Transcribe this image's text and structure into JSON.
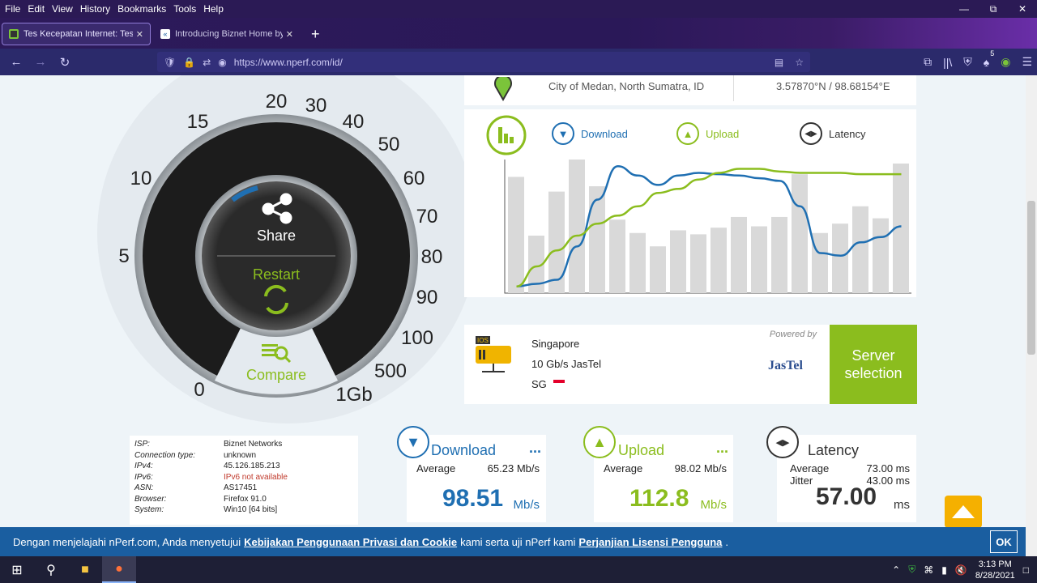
{
  "menu": [
    "File",
    "Edit",
    "View",
    "History",
    "Bookmarks",
    "Tools",
    "Help"
  ],
  "tabs": [
    {
      "title": "Tes Kecepatan Internet: Tes kone",
      "active": true
    },
    {
      "title": "Introducing Biznet Home by Bi",
      "active": false
    }
  ],
  "address": {
    "url": "https://www.nperf.com/id/"
  },
  "extension_badge": "5",
  "location": {
    "city": "City of Medan, North Sumatra, ID",
    "coords": "3.57870°N / 98.68154°E"
  },
  "legend": {
    "download": "Download",
    "upload": "Upload",
    "latency": "Latency"
  },
  "gauge": {
    "ticks": [
      "0",
      "5",
      "10",
      "15",
      "20",
      "30",
      "40",
      "50",
      "60",
      "70",
      "80",
      "90",
      "100",
      "500",
      "1Gb"
    ],
    "share_label": "Share",
    "restart_label": "Restart",
    "compare_label": "Compare"
  },
  "server": {
    "city": "Singapore",
    "provider": "10 Gb/s JasTel",
    "country": "SG",
    "powered_by": "Powered by",
    "sponsor_logo": "JasTel",
    "select_label": "Server selection"
  },
  "info": [
    {
      "k": "ISP:",
      "v": "Biznet Networks"
    },
    {
      "k": "Connection type:",
      "v": "unknown"
    },
    {
      "k": "IPv4:",
      "v": "45.126.185.213"
    },
    {
      "k": "IPv6:",
      "v": "IPv6 not available",
      "warn": true
    },
    {
      "k": "ASN:",
      "v": "AS17451"
    },
    {
      "k": "Browser:",
      "v": "Firefox 91.0"
    },
    {
      "k": "System:",
      "v": "Win10 [64 bits]"
    }
  ],
  "results": {
    "download": {
      "title": "Download",
      "more": "...",
      "avg_label": "Average",
      "avg": "65.23 Mb/s",
      "value": "98.51",
      "unit": "Mb/s"
    },
    "upload": {
      "title": "Upload",
      "more": "...",
      "avg_label": "Average",
      "avg": "98.02 Mb/s",
      "value": "112.8",
      "unit": "Mb/s"
    },
    "latency": {
      "title": "Latency",
      "avg_label": "Average",
      "avg": "73.00 ms",
      "jitter_label": "Jitter",
      "jitter": "43.00 ms",
      "value": "57.00",
      "unit": "ms"
    }
  },
  "cookie": {
    "text1": "Dengan menjelajahi nPerf.com, Anda menyetujui",
    "link1": "Kebijakan Penggunaan Privasi dan Cookie",
    "text2": "kami serta uji nPerf kami",
    "link2": "Perjanjian Lisensi Pengguna",
    "text3": ".",
    "ok": "OK"
  },
  "clock": {
    "time": "3:13 PM",
    "date": "8/28/2021"
  },
  "colors": {
    "download": "#1f6fb2",
    "upload": "#8bbd1e",
    "latency": "#333333",
    "server": "#8bbd1e"
  },
  "chart_data": {
    "type": "line",
    "bars": [
      0.87,
      0.43,
      0.76,
      1.0,
      0.8,
      0.55,
      0.45,
      0.35,
      0.47,
      0.44,
      0.49,
      0.57,
      0.5,
      0.57,
      0.89,
      0.45,
      0.52,
      0.65,
      0.56,
      0.97
    ],
    "series": [
      {
        "name": "Download",
        "values": [
          0.05,
          0.07,
          0.1,
          0.35,
          0.7,
          0.95,
          0.88,
          0.81,
          0.88,
          0.9,
          0.89,
          0.88,
          0.86,
          0.84,
          0.65,
          0.3,
          0.28,
          0.38,
          0.42,
          0.5
        ]
      },
      {
        "name": "Upload",
        "values": [
          0.05,
          0.2,
          0.32,
          0.43,
          0.52,
          0.58,
          0.65,
          0.75,
          0.78,
          0.85,
          0.9,
          0.93,
          0.93,
          0.91,
          0.9,
          0.9,
          0.9,
          0.89,
          0.89,
          0.89
        ]
      }
    ]
  }
}
